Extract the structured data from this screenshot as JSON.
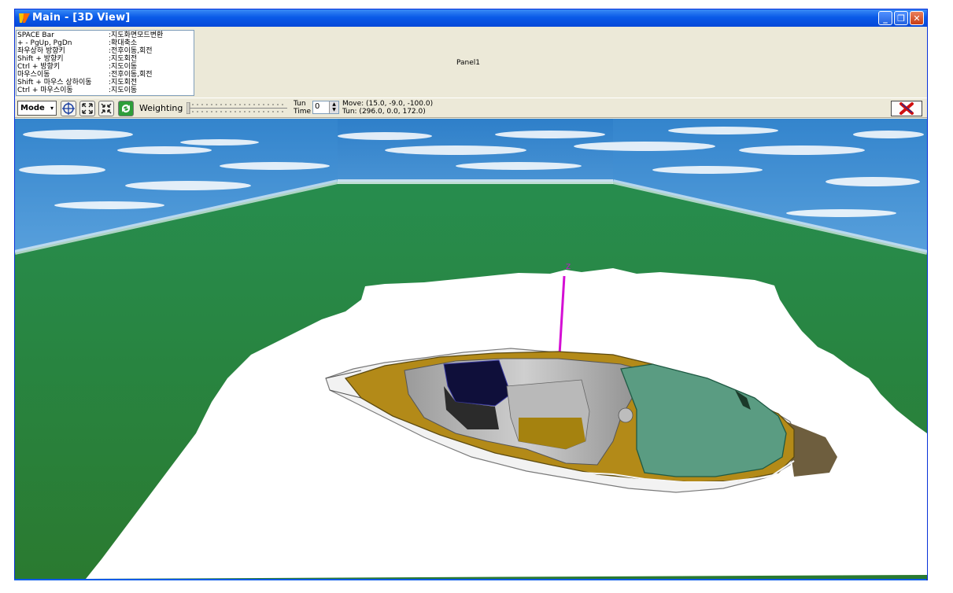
{
  "window": {
    "title": "Main - [3D View]",
    "controls": {
      "minimize": "_",
      "restore": "❐",
      "close": "✕"
    }
  },
  "keyhelp": [
    {
      "key": "SPACE Bar",
      "action": ":지도화면모드변환"
    },
    {
      "key": "+ - PgUp, PgDn",
      "action": ":확대축소"
    },
    {
      "key": "좌우상하 방향키",
      "action": ":전후이동,회전"
    },
    {
      "key": "Shift + 방향키",
      "action": ":지도회전"
    },
    {
      "key": "Ctrl + 방향키",
      "action": ":지도이동"
    },
    {
      "key": "마우스이동",
      "action": ":전후이동,회전"
    },
    {
      "key": "Shift + 마우스 상하이동",
      "action": ":지도회전"
    },
    {
      "key": "Ctrl + 마우스이동",
      "action": ":지도이동"
    }
  ],
  "panel": {
    "caption": "Panel1"
  },
  "toolbar": {
    "mode_label": "Mode",
    "weighting_label": "Weighting",
    "tun_label": "Tun",
    "time_label": "Time",
    "tun_value": "0",
    "move_text": "Move: (15.0, -9.0, -100.0)",
    "turn_text": "Tun: (296.0, 0.0, 172.0)"
  },
  "viewport": {
    "axis_label": "Z"
  },
  "colors": {
    "titlebar": "#0a5ae8",
    "chrome": "#ece9d8",
    "sea": "#2f8a44",
    "land": "#ffffff",
    "island_ochre": "#b38a18",
    "island_teal": "#5a9c82",
    "axis": "#d40fd4"
  },
  "icons": [
    "app-icon",
    "crosshair-icon",
    "expand-icon",
    "shrink-icon",
    "refresh-icon",
    "exit-x-icon"
  ]
}
